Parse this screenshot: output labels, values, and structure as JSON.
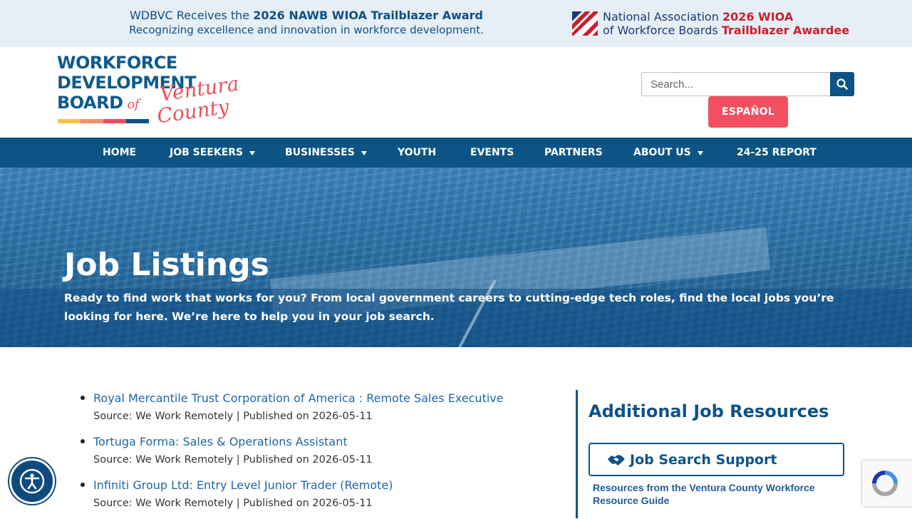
{
  "banner": {
    "line1_prefix": "WDBVC Receives the ",
    "line1_bold": "2026 NAWB WIOA Trailblazer Award",
    "line2": "Recognizing excellence and innovation in workforce development.",
    "nawb_line1": "National Association",
    "nawb_line2": "of Workforce Boards",
    "award_line1": "2026 WIOA",
    "award_line2": "Trailblazer Awardee"
  },
  "logo": {
    "line1": "WORKFORCE",
    "line2": "DEVELOPMENT",
    "line3": "BOARD",
    "of": "of",
    "script1": "Ventura",
    "script2": "County"
  },
  "search": {
    "placeholder": "Search..."
  },
  "language_button": "ESPAÑOL",
  "nav": [
    {
      "label": "HOME"
    },
    {
      "label": "JOB SEEKERS"
    },
    {
      "label": "BUSINESSES"
    },
    {
      "label": "YOUTH"
    },
    {
      "label": "EVENTS"
    },
    {
      "label": "PARTNERS"
    },
    {
      "label": "ABOUT US"
    },
    {
      "label": "24-25 REPORT"
    }
  ],
  "hero": {
    "title": "Job Listings",
    "text": "Ready to find work that works for you? From local government careers to cutting-edge tech roles, find the local jobs you’re looking for here. We’re here to help you in your job search."
  },
  "jobs": [
    {
      "title": "Royal Mercantile Trust Corporation of America : Remote Sales Executive",
      "meta": "Source: We Work Remotely | Published on 2026-05-11"
    },
    {
      "title": "Tortuga Forma: Sales & Operations Assistant",
      "meta": "Source: We Work Remotely | Published on 2026-05-11"
    },
    {
      "title": "Infiniti Group Ltd: Entry Level Junior Trader (Remote)",
      "meta": "Source: We Work Remotely | Published on 2026-05-11"
    }
  ],
  "sidebar": {
    "title": "Additional Job Resources",
    "button_label": "Job Search Support",
    "link": "Resources from the Ventura County Workforce Resource Guide"
  },
  "icons": {
    "search": "search-icon",
    "handshake": "handshake-icon",
    "accessibility": "accessibility-icon",
    "recaptcha": "recaptcha-icon"
  },
  "colors": {
    "primary_blue": "#0c5485",
    "accent_coral": "#f2505f",
    "link_blue": "#2166a8",
    "banner_bg": "#e6eef6"
  }
}
